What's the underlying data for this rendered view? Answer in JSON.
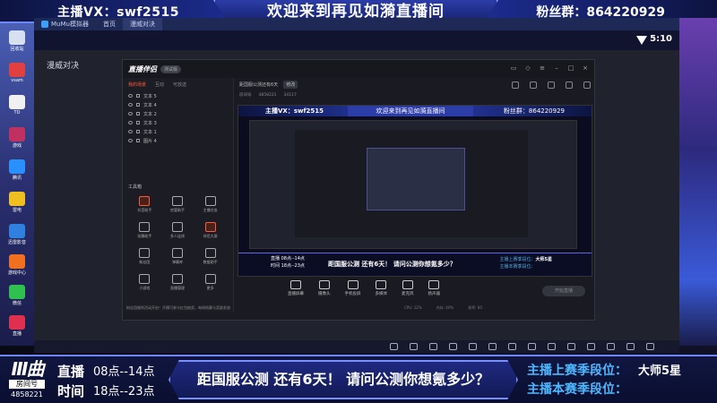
{
  "overlay": {
    "top_left": "主播VX：swf2515",
    "top_center": "欢迎来到再见如漪直播间",
    "top_right": "粉丝群：864220929"
  },
  "desktop_icons": [
    "回收站",
    "vsam",
    "TD",
    "游戏",
    "腾讯",
    "雷电",
    "迅雷影音",
    "游戏中心",
    "微信",
    "直播"
  ],
  "emulator": {
    "tabs": [
      "MuMu模拟器",
      "首页",
      "漫威对决"
    ],
    "time": "5:10",
    "app_title": "漫威对决"
  },
  "live_assistant": {
    "logo": "直播伴侣",
    "version_tag": "测试版",
    "left_tabs": [
      "我的场景",
      "互动",
      "可放送"
    ],
    "sources": [
      "文本 5",
      "文本 4",
      "文本 2",
      "文本 3",
      "文本 1",
      "图片 4"
    ],
    "tools_title": "工具箱",
    "tools": [
      "抖音助手",
      "房管助手",
      "主播任务",
      "炫舞助手",
      "多人连线",
      "伴侣大屏",
      "粉丝团",
      "弹幕库",
      "数据助手",
      "小游戏",
      "直播管理",
      "更多"
    ],
    "notice": "粉丝团福利活动开启！开播可参与红包抽奖，每周结算与奖励发放",
    "room_title": "距国服公测还有6天",
    "edit_label": "修改",
    "sub_items": [
      "房间号",
      "4858221",
      "34117"
    ],
    "actions": [
      "直播屏幕",
      "摄像头",
      "手机投屏",
      "多媒体",
      "麦克风",
      "扬声器"
    ],
    "start_label": "开始直播",
    "status": [
      "CPU: 12%",
      "内存: 40%",
      "帧率: 60"
    ]
  },
  "preview": {
    "top_left": "主播VX：swf2515",
    "top_center": "欢迎来到再见如漪直播间",
    "top_right": "粉丝群：864220929",
    "bottom_live": "直播 08点--14点",
    "bottom_time": "时间 18点--23点",
    "bottom_msg": "距国服公测 还有6天！ 请问公测你想氪多少？",
    "rank_a_label": "主播上赛季段位：",
    "rank_a_val": "大师5星",
    "rank_b_label": "主播本赛季段位："
  },
  "bottom": {
    "room_logo": "Ⅲ曲",
    "room_label": "房间号",
    "room_num": "4858221",
    "live_label": "直播",
    "time_label": "时间",
    "live_hours": "08点--14点",
    "time_hours": "18点--23点",
    "notice": "距国服公测 还有6天！ 请问公测你想氪多少？",
    "rank_last_label": "主播上赛季段位：",
    "rank_last_value": "大师5星",
    "rank_this_label": "主播本赛季段位："
  }
}
